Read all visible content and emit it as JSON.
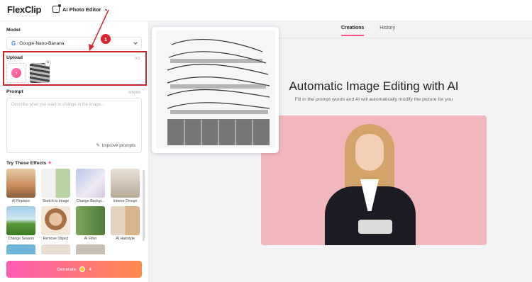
{
  "header": {
    "logo": "FlexClip",
    "app_name": "AI Photo Editor"
  },
  "sidebar": {
    "model_label": "Model",
    "model_value": "Google-Nano-Banana",
    "upload_label": "Upload",
    "upload_count": "0/3",
    "prompt_label": "Prompt",
    "prompt_count": "0/5000",
    "prompt_placeholder": "Describe what you want to change in the image...",
    "improve_label": "Improve prompts",
    "effects_title": "Try These Effects",
    "effects": [
      {
        "label": "AI Replace"
      },
      {
        "label": "Sketch to Image"
      },
      {
        "label": "Change Backgr..."
      },
      {
        "label": "Interior Design"
      },
      {
        "label": "Change Season"
      },
      {
        "label": "Remove Object"
      },
      {
        "label": "AI Filter"
      },
      {
        "label": "AI Hairstyle"
      }
    ],
    "generate_label": "Generate",
    "generate_cost": "4"
  },
  "main": {
    "tabs": [
      {
        "label": "Creations",
        "active": true
      },
      {
        "label": "History",
        "active": false
      }
    ],
    "headline": "Automatic Image Editing with AI",
    "subtitle": "Fill in the prompt words and AI will automatically modify the picture for you"
  },
  "annotation": {
    "step_number": "1"
  },
  "colors": {
    "accent": "#ff4f86",
    "highlight": "#c9262c",
    "generate_start": "#ff5bb3",
    "generate_end": "#ff8a4c"
  }
}
